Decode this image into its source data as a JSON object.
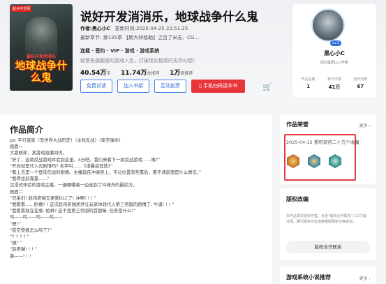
{
  "book": {
    "cover_tag": "起点中文网",
    "cover_small": "最好开发消消乐",
    "cover_big": "地球战争什么鬼",
    "title": "说好开发消消乐，地球战争什么鬼",
    "author_label": "作者:",
    "author": "黑心小C",
    "updated": "更新时间:2025-04-25 22:51:25",
    "latest": "最新章节: 第135章 【斯大林格勒】之舌了米无、CG...",
    "tags": "连载 · 签约 · VIP · 游戏 · 游戏系统",
    "tagline": "疑傻丧逼脑管的游戏入生，打破现实框架的无尽幻想！",
    "stats": [
      {
        "num": "40.54万",
        "unit": "字"
      },
      {
        "num": "11.74万",
        "unit": "总推荐"
      },
      {
        "num": "1万",
        "unit": "周推荐"
      }
    ],
    "buttons": {
      "free_read": "免费试读",
      "add_shelf": "加入书架",
      "interact": "互动投票",
      "phone": "手机扫码读本书"
    },
    "cart_icon": "cart-icon"
  },
  "author_card": {
    "name": "黑心小C",
    "level": "Lv.2",
    "role": "阅文集团Lv.2作家",
    "stats": [
      {
        "label": "作品总数",
        "value": "1"
      },
      {
        "label": "累计字数",
        "value": "41万"
      },
      {
        "label": "创作天数",
        "value": "67"
      }
    ]
  },
  "intro": {
    "heading": "作品简介",
    "lines": [
      "ps: 平行蓝星（无世界大战历史）（主张反战）（架空保命）",
      "画面一",
      "大夏联邦，某游戏直播间内。",
      "“好了，这款反战游戏体验到这里，4分吧。我们来看下一款反战游戏……咦?”",
      "“开局就是代入式剧情吗? 名字叫……《诺曼底登陆》”",
      "“看上去是一个登陆作战的剧情。主播现在冲滩吞上，不过位置有些靠后，看不清前面是什么情况。”",
      "“我得往前靠靠……”",
      "沉浸式体验的游戏主播，一遍嘟囔着一边走到了冲滩舟的最前方。",
      "画面二",
      "“兄弟们! 赵鸡老贼又更新DLC了! 冲啊! ! ! ”",
      "“我看看……卧槽? ! 这次赵鸡老贼居然让玩家体验代入第三帝国的剧情了, 牛逼! ! ! ”",
      "“我看看现在在哪, 柏林? 这不是第三帝国的首都嘛, 任务是什么?”",
      "呜——呜——呜——呜——",
      "“嗯?”",
      "“防空警报怎么响了?”",
      "“? ? ? ? ”",
      "“随! ”",
      "“赵老贼! ! ! ”",
      "轰——! ! !"
    ]
  },
  "honor": {
    "title": "作品荣誉",
    "more": "更多",
    "date_line": "2025-04-12 累积获得二十万个收藏"
  },
  "rights": {
    "title": "版权改编",
    "desc": "本作品相关版权可售。点击“版权合作联系”入口了解详情。腾讯版权可售或荣耀版图权法等咨询。",
    "contact": "版权合作联系"
  },
  "rec": {
    "title": "游戏系统小说推荐",
    "more": "更多"
  }
}
